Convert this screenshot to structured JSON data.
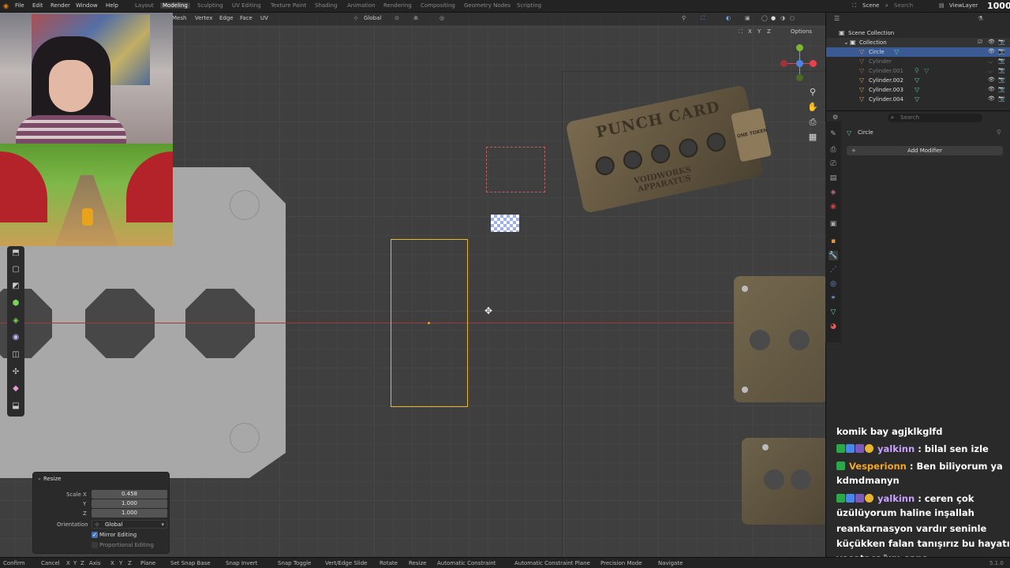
{
  "topbar": {
    "menus": [
      "File",
      "Edit",
      "Render",
      "Window",
      "Help"
    ],
    "workspaces": [
      "Layout",
      "Modeling",
      "Sculpting",
      "UV Editing",
      "Texture Paint",
      "Shading",
      "Animation",
      "Rendering",
      "Compositing",
      "Geometry Nodes",
      "Scripting"
    ],
    "active_workspace": "Modeling",
    "scene": "Scene",
    "view_layer": "ViewLayer",
    "search_placeholder": "Search",
    "counter": "1000"
  },
  "viewport_header": {
    "menus": [
      "Mesh",
      "Vertex",
      "Edge",
      "Face",
      "UV"
    ],
    "orientation": "Global",
    "axis_x": "X",
    "axis_y": "Y",
    "axis_z": "Z",
    "options_label": "Options"
  },
  "punch_card": {
    "title": "PUNCH CARD",
    "subtitle_1": "VOIDWORKS",
    "subtitle_2": "APPARATUS",
    "tab_text": "ONE TOKEN"
  },
  "resize_panel": {
    "title": "Resize",
    "scale_x_label": "Scale X",
    "scale_x": "0.458",
    "y_label": "Y",
    "scale_y": "1.000",
    "z_label": "Z",
    "scale_z": "1.000",
    "orientation_label": "Orientation",
    "orientation_value": "Global",
    "mirror_editing_label": "Mirror Editing",
    "mirror_editing_checked": true,
    "proportional_editing_label": "Proportional Editing",
    "proportional_editing_checked": false
  },
  "outliner": {
    "header": "Scene Collection",
    "collection": "Collection",
    "items": [
      {
        "name": "Circle",
        "selected": true
      },
      {
        "name": "Cylinder",
        "selected": false
      },
      {
        "name": "Cylinder.001",
        "selected": false
      },
      {
        "name": "Cylinder.002",
        "selected": false
      },
      {
        "name": "Cylinder.003",
        "selected": false
      },
      {
        "name": "Cylinder.004",
        "selected": false
      }
    ]
  },
  "properties": {
    "search_placeholder": "Search",
    "object_name": "Circle",
    "add_modifier_label": "Add Modifier"
  },
  "chat": [
    {
      "user": "",
      "message": "komik bay agjklkglfd",
      "user_color": "#ffffff"
    },
    {
      "user": "yalkinn",
      "message": " : bilal sen izle",
      "user_color": "#c8a0ff"
    },
    {
      "user": "Vesperionn",
      "message": " : Ben biliyorum ya",
      "user_color": "#f5a623"
    },
    {
      "user": "",
      "message": "kdmdmanyn",
      "user_color": "#ffffff"
    },
    {
      "user": "yalkinn",
      "message": " : ceren çok",
      "user_color": "#c8a0ff"
    },
    {
      "user": "",
      "message": "üzülüyorum haline inşallah",
      "user_color": "#ffffff"
    },
    {
      "user": "",
      "message": "reankarnasyon vardır seninle",
      "user_color": "#ffffff"
    },
    {
      "user": "",
      "message": "küçükken falan tanışırız bu hayatı",
      "user_color": "#ffffff"
    },
    {
      "user": "",
      "message": "yaşatacağım sana",
      "user_color": "#ffffff"
    }
  ],
  "statusbar": {
    "items": [
      "Confirm",
      "Cancel",
      "X",
      "Y",
      "Z",
      "Axis",
      "X",
      "Y",
      "Z",
      "Plane",
      "Set Snap Base",
      "Snap Invert",
      "Snap Toggle",
      "Vert/Edge Slide",
      "Rotate",
      "Resize",
      "Automatic Constraint",
      "Automatic Constraint Plane",
      "Precision Mode",
      "Navigate"
    ],
    "version": "5.1.0"
  }
}
